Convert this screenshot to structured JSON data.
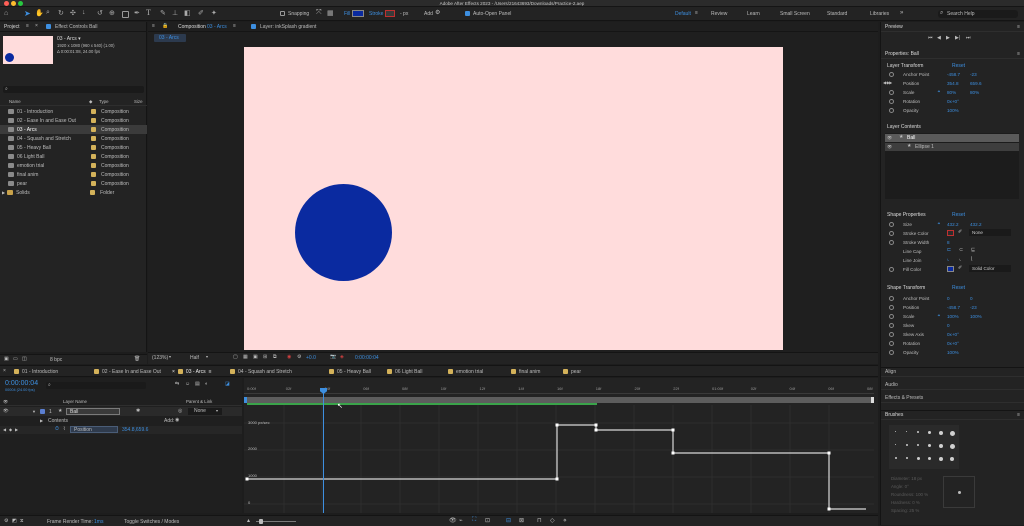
{
  "app": {
    "title": "Adobe After Effects 2023 - /Users/21643693/Downloads/Practice-2.aep"
  },
  "toolbar": {
    "snapping": "Snapping",
    "fill": "Fill",
    "stroke": "Stroke",
    "stroke_px": "- px",
    "add": "Add",
    "auto_open": "Auto-Open Panel",
    "fill_color": "#0a2aa0"
  },
  "workspaces": [
    "Default",
    "Review",
    "Learn",
    "Small Screen",
    "Standard",
    "Libraries"
  ],
  "search_help": "Search Help",
  "project": {
    "tab": "Project",
    "effect_tab": "Effect Controls Ball",
    "comp_name": "03 - Arcs ▾",
    "comp_info1": "1920 x 1080 (960 x 540) (1.00)",
    "comp_info2": "Δ 0:00:01:08, 24.00 fps",
    "columns": [
      "Name",
      "Type",
      "Size"
    ],
    "items": [
      {
        "name": "01 - Introduction",
        "type": "Composition"
      },
      {
        "name": "02 - Ease In and Ease Out",
        "type": "Composition"
      },
      {
        "name": "03 - Arcs",
        "type": "Composition"
      },
      {
        "name": "04 - Squash and Stretch",
        "type": "Composition"
      },
      {
        "name": "05 - Heavy Ball",
        "type": "Composition"
      },
      {
        "name": "06 Light Ball",
        "type": "Composition"
      },
      {
        "name": "emotion trial",
        "type": "Composition"
      },
      {
        "name": "final anim",
        "type": "Composition"
      },
      {
        "name": "pear",
        "type": "Composition"
      },
      {
        "name": "Solids",
        "type": "Folder"
      }
    ],
    "bpc": "8 bpc"
  },
  "composition": {
    "tab_label": "Composition",
    "tab_name": "03 - Arcs",
    "layer_tab": "Layer: inkSplash gradient",
    "breadcrumb": "03 - Arcs",
    "bg_color": "#ffdcdc",
    "ball_color": "#0a2aa0",
    "zoom": "(123%)",
    "resolution": "Half",
    "exposure": "+0.0",
    "timecode": "0:00:00:04"
  },
  "timeline": {
    "tabs": [
      "01 - Introduction",
      "02 - Ease In and Ease Out",
      "03 - Arcs",
      "04 - Squash and Stretch",
      "05 - Heavy Ball",
      "06 Light Ball",
      "emotion trial",
      "final anim",
      "pear"
    ],
    "current_time": "0:00:00:04",
    "fps_info": "00004 (24.00 fps)",
    "col_layer_name": "Layer Name",
    "col_parent": "Parent & Link",
    "layer_num": "1",
    "layer_name": "Ball",
    "parent": "None",
    "contents": "Contents",
    "add": "Add:",
    "prop_name": "Position",
    "prop_value": "354.8,659.6",
    "ruler": [
      "0:00f",
      "02f",
      "04f",
      "06f",
      "08f",
      "10f",
      "12f",
      "14f",
      "16f",
      "18f",
      "20f",
      "22f",
      "01:00f",
      "02f",
      "04f",
      "06f",
      "08f"
    ],
    "graph_labels": [
      "3000 px/sec",
      "2000",
      "1000",
      "0"
    ],
    "render_time_label": "Frame Render Time:",
    "render_time": "1ms",
    "toggle": "Toggle Switches / Modes"
  },
  "preview": {
    "title": "Preview"
  },
  "properties": {
    "title": "Properties: Ball",
    "layer_transform": "Layer Transform",
    "reset": "Reset",
    "transform": [
      {
        "label": "Anchor Point",
        "v1": "-458.7",
        "v2": "-23"
      },
      {
        "label": "Position",
        "v1": "354.8",
        "v2": "659.6"
      },
      {
        "label": "Scale",
        "v1": "80%",
        "v2": "80%"
      },
      {
        "label": "Rotation",
        "v1": "0x+0°",
        "v2": ""
      },
      {
        "label": "Opacity",
        "v1": "100%",
        "v2": ""
      }
    ],
    "layer_contents": "Layer Contents",
    "contents": [
      "Ball",
      "Ellipse 1"
    ],
    "shape_properties": "Shape Properties",
    "shape": [
      {
        "label": "Size",
        "v1": "432.2",
        "v2": "432.2"
      },
      {
        "label": "Stroke Color",
        "v1": "None",
        "v2": ""
      },
      {
        "label": "Stroke Width",
        "v1": "8",
        "v2": ""
      },
      {
        "label": "Line Cap",
        "v1": "",
        "v2": ""
      },
      {
        "label": "Line Join",
        "v1": "",
        "v2": ""
      },
      {
        "label": "Fill Color",
        "v1": "Solid Color",
        "v2": ""
      }
    ],
    "shape_transform": "Shape Transform",
    "shape_tr": [
      {
        "label": "Anchor Point",
        "v1": "0",
        "v2": "0"
      },
      {
        "label": "Position",
        "v1": "-458.7",
        "v2": "-23"
      },
      {
        "label": "Scale",
        "v1": "100%",
        "v2": "100%"
      },
      {
        "label": "Skew",
        "v1": "0",
        "v2": ""
      },
      {
        "label": "Skew Axis",
        "v1": "0x+0°",
        "v2": ""
      },
      {
        "label": "Rotation",
        "v1": "0x+0°",
        "v2": ""
      },
      {
        "label": "Opacity",
        "v1": "100%",
        "v2": ""
      }
    ]
  },
  "side_panels": [
    "Align",
    "Audio",
    "Effects & Presets"
  ],
  "brushes": {
    "title": "Brushes",
    "diameter": "Diameter: 18 px",
    "angle": "Angle: 0°",
    "roundness": "Roundness: 100 %",
    "hardness": "Hardness: 0 %",
    "spacing": "Spacing: 25 %"
  }
}
